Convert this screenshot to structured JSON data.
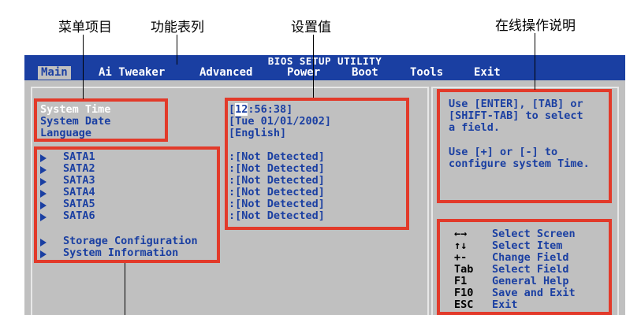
{
  "annotations": {
    "menu_items": "菜单项目",
    "function_list": "功能表列",
    "settings_value": "设置值",
    "online_help": "在线操作说明"
  },
  "bios": {
    "title": "BIOS SETUP UTILITY",
    "menu": [
      "Main",
      "Ai Tweaker",
      "Advanced",
      "Power",
      "Boot",
      "Tools",
      "Exit"
    ],
    "active_menu": "Main",
    "items": {
      "system_time": "System Time",
      "system_date": "System Date",
      "language": "Language"
    },
    "values": {
      "time_hour": "12",
      "time_rest": ":56:38]",
      "date": "[Tue 01/01/2002]",
      "language": "[English]"
    },
    "sata": [
      {
        "label": "SATA1",
        "value": ":[Not Detected]"
      },
      {
        "label": "SATA2",
        "value": ":[Not Detected]"
      },
      {
        "label": "SATA3",
        "value": ":[Not Detected]"
      },
      {
        "label": "SATA4",
        "value": ":[Not Detected]"
      },
      {
        "label": "SATA5",
        "value": ":[Not Detected]"
      },
      {
        "label": "SATA6",
        "value": ":[Not Detected]"
      }
    ],
    "submenus": [
      "Storage Configuration",
      "System Information"
    ],
    "help": {
      "line1": "Use [ENTER], [TAB] or",
      "line2": "[SHIFT-TAB] to select",
      "line3": "a field.",
      "line4": "Use [+] or [-] to",
      "line5": "configure system Time."
    },
    "keys": [
      {
        "key": "←→",
        "desc": "Select Screen"
      },
      {
        "key": "↑↓",
        "desc": "Select Item"
      },
      {
        "key": "+-",
        "desc": "Change Field"
      },
      {
        "key": "Tab",
        "desc": "Select Field"
      },
      {
        "key": "F1",
        "desc": "General Help"
      },
      {
        "key": "F10",
        "desc": "Save and Exit"
      },
      {
        "key": "ESC",
        "desc": "Exit"
      }
    ],
    "colors": {
      "header": "#1a3fa2",
      "panel": "#c0c0c0",
      "highlight": "#e23a2a"
    }
  }
}
